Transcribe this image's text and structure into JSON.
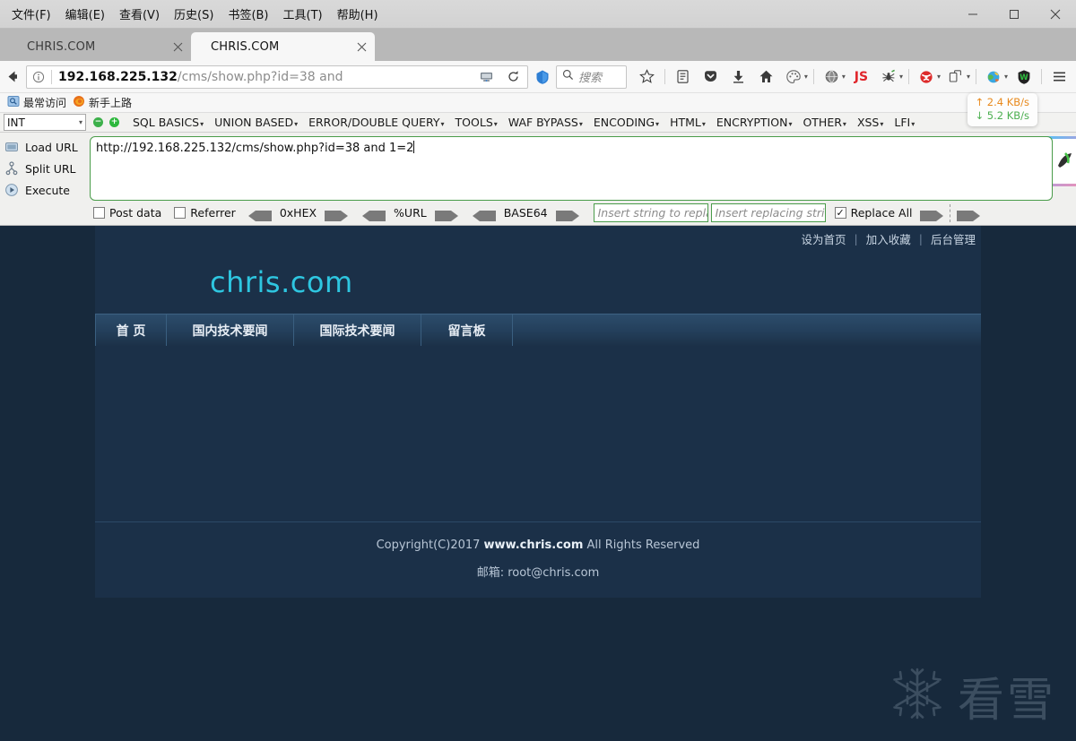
{
  "window": {
    "menu": [
      "文件(F)",
      "编辑(E)",
      "查看(V)",
      "历史(S)",
      "书签(B)",
      "工具(T)",
      "帮助(H)"
    ],
    "minimize_label": "−",
    "maximize_label": "□",
    "close_label": "✕"
  },
  "tabs": [
    {
      "title": "CHRIS.COM",
      "active": false
    },
    {
      "title": "CHRIS.COM",
      "active": true
    }
  ],
  "navbar": {
    "back_icon": "back-arrow-icon",
    "url_host": "192.168.225.132",
    "url_path": "/cms/show.php?id=38 and",
    "search_placeholder": "搜索",
    "toolbar_icons": [
      "star-icon",
      "library-icon",
      "pocket-icon",
      "download-icon",
      "home-icon",
      "palette-icon",
      "globe-icon",
      "js-icon",
      "spider-icon",
      "red-circle-icon",
      "tabs-icon",
      "color-globe-icon",
      "shield-w-icon",
      "hamburger-menu-icon"
    ]
  },
  "bookmarks": [
    {
      "label": "最常访问",
      "icon": "most-visited-icon"
    },
    {
      "label": "新手上路",
      "icon": "firefox-icon"
    }
  ],
  "hackbar": {
    "type_select": "INT",
    "minus_button": "−",
    "plus_button": "+",
    "menu": [
      "SQL BASICS",
      "UNION BASED",
      "ERROR/DOUBLE QUERY",
      "TOOLS",
      "WAF BYPASS",
      "ENCODING",
      "HTML",
      "ENCRYPTION",
      "OTHER",
      "XSS",
      "LFI"
    ],
    "actions": [
      {
        "label": "Load URL",
        "icon": "load-url-icon"
      },
      {
        "label": "Split URL",
        "icon": "split-url-icon"
      },
      {
        "label": "Execute",
        "icon": "execute-icon"
      }
    ],
    "url_value": "http://192.168.225.132/cms/show.php?id=38 and 1=2",
    "options": {
      "post_data": {
        "label": "Post data",
        "checked": false
      },
      "referrer": {
        "label": "Referrer",
        "checked": false
      },
      "hex_label": "0xHEX",
      "url_label": "%URL",
      "base64_label": "BASE64",
      "replace_from_placeholder": "Insert string to replace",
      "replace_to_placeholder": "Insert replacing string",
      "replace_all": {
        "label": "Replace All",
        "checked": true
      }
    }
  },
  "netspeed": {
    "upload": "2.4 KB/s",
    "download": "5.2 KB/s",
    "up_arrow": "↑",
    "down_arrow": "↓",
    "up_color": "#e8891c",
    "down_color": "#4caf50"
  },
  "page": {
    "top_links": [
      "设为首页",
      "加入收藏",
      "后台管理"
    ],
    "separator": "|",
    "logo": "chris.com",
    "logo_color": "#2ec6e0",
    "nav": [
      "首 页",
      "国内技术要闻",
      "国际技术要闻",
      "留言板"
    ],
    "footer_line1_prefix": "Copyright(C)2017 ",
    "footer_line1_strong": "www.chris.com",
    "footer_line1_suffix": " All Rights Reserved",
    "footer_line2": "邮箱: root@chris.com",
    "background_color": "#1b3048"
  },
  "watermark": {
    "icon": "snowflake-icon",
    "text": "看雪"
  }
}
